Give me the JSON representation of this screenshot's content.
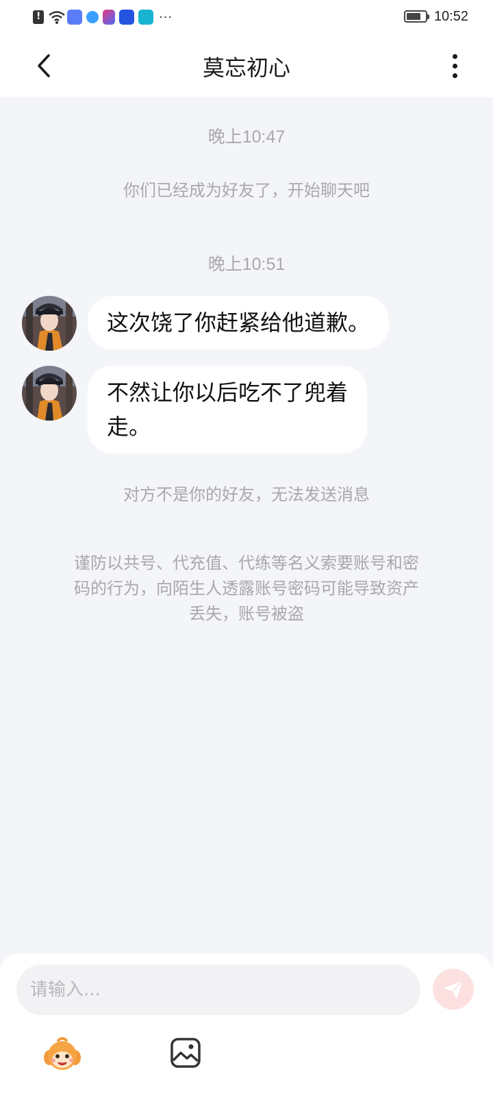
{
  "status_bar": {
    "time": "10:52",
    "more_indicator": "···",
    "icons": [
      "alert-icon",
      "wifi-icon",
      "app-notification-icon",
      "app-notification-icon",
      "app-notification-icon",
      "app-notification-icon",
      "app-notification-icon",
      "battery-icon"
    ]
  },
  "header": {
    "title": "莫忘初心",
    "back_icon": "chevron-left-icon",
    "more_icon": "more-vertical-icon"
  },
  "chat": {
    "timestamp_1": "晚上10:47",
    "system_friend_added": "你们已经成为好友了，开始聊天吧",
    "timestamp_2": "晚上10:51",
    "messages": [
      {
        "sender": "other",
        "text": "这次饶了你赶紧给他道歉。"
      },
      {
        "line1": "不然让你以后吃不了兜着",
        "line2": "走。",
        "sender": "other"
      }
    ],
    "system_not_friend": "对方不是你的好友，无法发送消息",
    "warning": {
      "line1": "谨防以共号、代充值、代练等名义索要账号和密",
      "line2": "码的行为，向陌生人透露账号密码可能导致资产",
      "line3": "丢失，账号被盗"
    }
  },
  "input_bar": {
    "placeholder": "请输入...",
    "send_icon": "send-icon",
    "emoji_icon": "emoji-icon",
    "image_icon": "image-icon"
  },
  "colors": {
    "background": "#f4f5f8",
    "system_text": "#a8a8ad",
    "send_button_disabled": "#fde1e1"
  }
}
